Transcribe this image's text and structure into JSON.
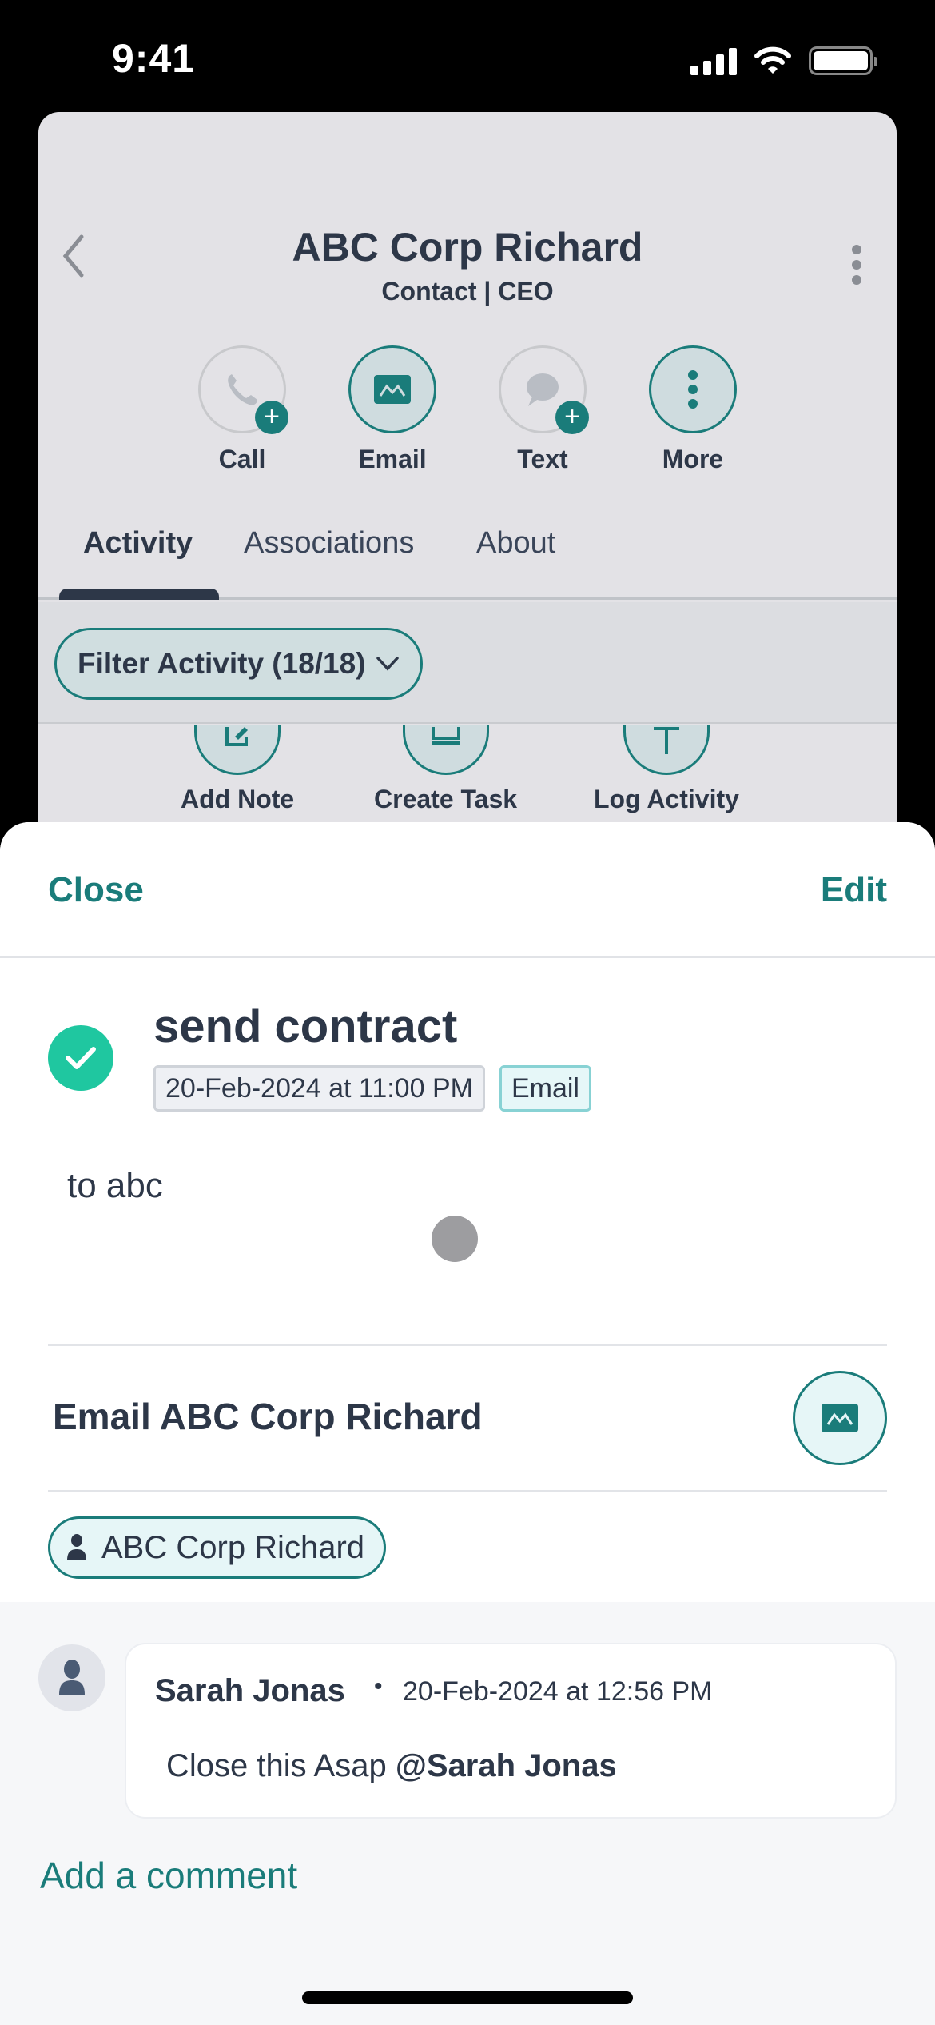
{
  "status_bar": {
    "time": "9:41"
  },
  "contact": {
    "name": "ABC Corp Richard",
    "subtitle": "Contact | CEO"
  },
  "actions": [
    {
      "label": "Call",
      "icon": "phone-icon",
      "active": false,
      "has_plus": true
    },
    {
      "label": "Email",
      "icon": "mail-icon",
      "active": true,
      "has_plus": false
    },
    {
      "label": "Text",
      "icon": "chat-bubble-icon",
      "active": false,
      "has_plus": true
    },
    {
      "label": "More",
      "icon": "kebab-icon",
      "active": true,
      "has_plus": false
    }
  ],
  "tabs": [
    {
      "label": "Activity",
      "active": true
    },
    {
      "label": "Associations",
      "active": false
    },
    {
      "label": "About",
      "active": false
    }
  ],
  "filter": {
    "label": "Filter Activity (18/18)"
  },
  "quick_actions": [
    {
      "label": "Add Note",
      "icon": "note-edit-icon"
    },
    {
      "label": "Create Task",
      "icon": "task-icon"
    },
    {
      "label": "Log Activity",
      "icon": "plus-icon"
    }
  ],
  "sheet": {
    "close_label": "Close",
    "edit_label": "Edit",
    "task": {
      "title": "send contract",
      "completed": true,
      "due": "20-Feb-2024 at 11:00 PM",
      "type": "Email",
      "body": "to abc"
    },
    "email_action_label": "Email ABC Corp Richard",
    "association": "ABC Corp Richard",
    "comment": {
      "author": "Sarah Jonas",
      "separator": "•",
      "timestamp": "20-Feb-2024 at 12:56 PM",
      "text_prefix": "Close this Asap ",
      "mention": "@Sarah Jonas"
    },
    "add_comment_label": "Add a comment"
  },
  "colors": {
    "accent": "#1a7c7a",
    "success": "#1fc7a0",
    "text": "#2d3748"
  }
}
